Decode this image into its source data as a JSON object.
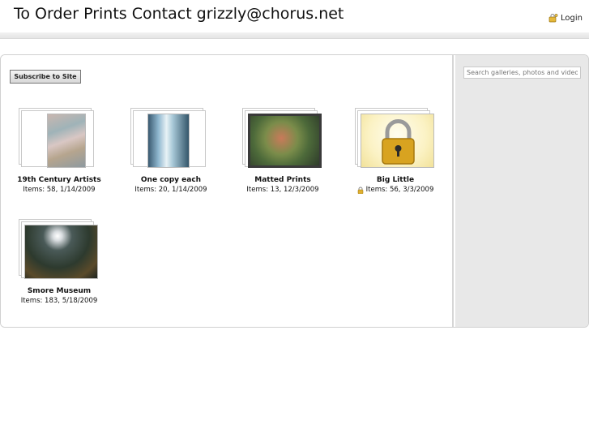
{
  "header": {
    "title": "To Order Prints Contact grizzly@chorus.net",
    "login_label": "Login"
  },
  "toolbar": {
    "subscribe_label": "Subscribe to Site"
  },
  "search": {
    "placeholder": "Search galleries, photos and videos"
  },
  "galleries": [
    {
      "title": "19th Century Artists",
      "meta": "Items: 58, 1/14/2009",
      "locked": false
    },
    {
      "title": "One copy each",
      "meta": "Items: 20, 1/14/2009",
      "locked": false
    },
    {
      "title": "Matted Prints",
      "meta": "Items: 13, 12/3/2009",
      "locked": false
    },
    {
      "title": "Big Little",
      "meta": "Items: 56, 3/3/2009",
      "locked": true
    },
    {
      "title": "Smore Museum",
      "meta": "Items: 183, 5/18/2009",
      "locked": false
    }
  ],
  "colors": {
    "sidebar_bg": "#e8e8e8",
    "lock_gold": "#d8a320"
  }
}
